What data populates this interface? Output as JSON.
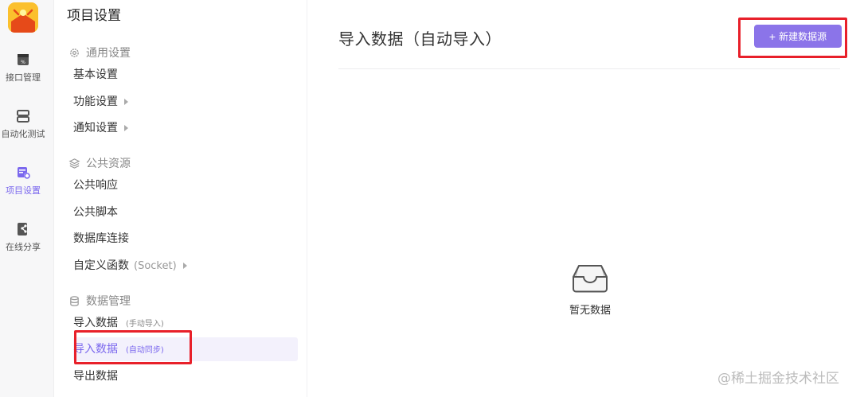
{
  "rail": {
    "items": [
      {
        "label": "接口管理",
        "icon": "api-icon"
      },
      {
        "label": "自动化测试",
        "icon": "server-icon"
      },
      {
        "label": "项目设置",
        "icon": "project-settings-icon"
      },
      {
        "label": "在线分享",
        "icon": "share-icon"
      }
    ],
    "active_index": 2,
    "accent_color": "#7b68ee"
  },
  "sidebar": {
    "title": "项目设置",
    "groups": [
      {
        "title": "通用设置",
        "icon": "gear-icon",
        "items": [
          {
            "label": "基本设置"
          },
          {
            "label": "功能设置"
          },
          {
            "label": "通知设置"
          }
        ]
      },
      {
        "title": "公共资源",
        "icon": "layers-icon",
        "items": [
          {
            "label": "公共响应"
          },
          {
            "label": "公共脚本"
          },
          {
            "label": "数据库连接"
          },
          {
            "label": "自定义函数",
            "suffix": "(Socket)"
          }
        ]
      },
      {
        "title": "数据管理",
        "icon": "database-icon",
        "items": [
          {
            "label": "导入数据",
            "suffix": "(手动导入)"
          },
          {
            "label": "导入数据",
            "suffix": "(自动同步)"
          },
          {
            "label": "导出数据"
          }
        ]
      }
    ]
  },
  "main": {
    "title": "导入数据（自动导入）",
    "new_button_label": "新建数据源",
    "empty_text": "暂无数据",
    "button_color": "#8b74e9"
  },
  "watermark": "@稀土掘金技术社区"
}
